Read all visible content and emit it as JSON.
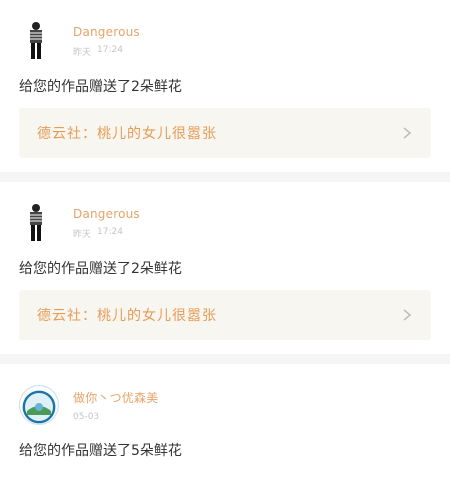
{
  "notifications": [
    {
      "avatar_icon": "person-figure-icon",
      "username": "Dangerous",
      "day": "昨天",
      "time": "17:24",
      "message": "给您的作品赠送了2朵鲜花",
      "work_title": "德云社：桃儿的女儿很嚣张"
    },
    {
      "avatar_icon": "person-figure-icon",
      "username": "Dangerous",
      "day": "昨天",
      "time": "17:24",
      "message": "给您的作品赠送了2朵鲜花",
      "work_title": "德云社：桃儿的女儿很嚣张"
    },
    {
      "avatar_icon": "landscape-avatar-icon",
      "username": "做你丶つ优森美",
      "day": "",
      "time": "05-03",
      "message": "给您的作品赠送了5朵鲜花",
      "work_title": ""
    }
  ],
  "colors": {
    "username": "#e6a36a",
    "work_title": "#e79c55",
    "work_bg": "#f7f6f1",
    "divider": "#f5f5f5"
  }
}
